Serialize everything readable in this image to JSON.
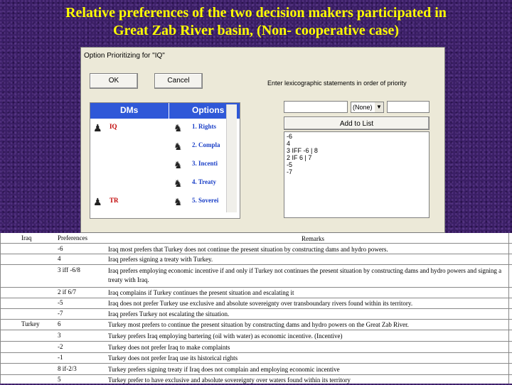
{
  "page": {
    "title_line1": "Relative preferences of the two decision makers participated in",
    "title_line2": "Great Zab River basin, (Non- cooperative case)"
  },
  "dialog": {
    "title": "Option Prioritizing for \"IQ\"",
    "ok_label": "OK",
    "cancel_label": "Cancel",
    "instruction": "Enter lexicographic statements in order of priority",
    "grid_header_dms": "DMs",
    "grid_header_options": "Options",
    "dms": [
      {
        "label": "IQ",
        "icon": "person-icon"
      },
      {
        "label": "TR",
        "icon": "person-icon"
      }
    ],
    "options": [
      "1. Rights",
      "2. Compla",
      "3. Incenti",
      "4. Treaty",
      "5. Soverei"
    ],
    "combo_value": "(None)",
    "add_to_list_label": "Add to List",
    "statements": [
      "-6",
      "4",
      "3 IFF -6 | 8",
      "2 IF 6 | 7",
      "-5",
      "-7"
    ]
  },
  "table": {
    "header": {
      "dm": "Iraq",
      "preferences": "Preferences",
      "remarks": "Remarks"
    },
    "rows": [
      {
        "dm": "",
        "pref": "-6",
        "remark": "Iraq most prefers that Turkey does not continue the present situation by constructing dams and hydro powers."
      },
      {
        "dm": "",
        "pref": "4",
        "remark": "Iraq prefers signing a treaty with Turkey."
      },
      {
        "dm": "",
        "pref": "3 iff -6/8",
        "remark": "Iraq prefers employing economic incentive if and only if Turkey not continues the present situation by constructing dams and hydro powers and signing a treaty with Iraq."
      },
      {
        "dm": "",
        "pref": "2 if 6/7",
        "remark": "Iraq complains if Turkey continues the present situation and escalating it"
      },
      {
        "dm": "",
        "pref": "-5",
        "remark": "Iraq does not prefer Turkey use exclusive and absolute sovereignty over transboundary rivers found within its territory."
      },
      {
        "dm": "",
        "pref": "-7",
        "remark": "Iraq prefers Turkey not escalating the situation."
      },
      {
        "dm": "Turkey",
        "pref": "6",
        "remark": "Turkey most prefers to continue the present situation by constructing dams and hydro powers on the Great Zab River."
      },
      {
        "dm": "",
        "pref": "3",
        "remark": "Turkey prefers Iraq employing bartering (oil with water) as economic incentive. (Incentive)"
      },
      {
        "dm": "",
        "pref": "-2",
        "remark": "Turkey does not prefer Iraq to make complaints"
      },
      {
        "dm": "",
        "pref": "-1",
        "remark": "Turkey does not prefer Iraq use its historical rights"
      },
      {
        "dm": "",
        "pref": "8 if-2/3",
        "remark": "Turkey prefers signing treaty if Iraq does not complain and employing economic incentive"
      },
      {
        "dm": "",
        "pref": "5",
        "remark": "Turkey prefer to have exclusive and absolute sovereignty over waters found within its territory"
      }
    ]
  }
}
